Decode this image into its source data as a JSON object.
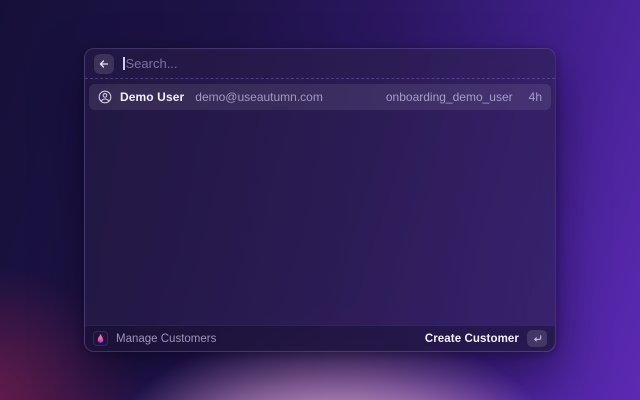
{
  "search": {
    "placeholder": "Search...",
    "value": ""
  },
  "results": [
    {
      "name": "Demo User",
      "email": "demo@useautumn.com",
      "id": "onboarding_demo_user",
      "time": "4h"
    }
  ],
  "footer": {
    "left_label": "Manage Customers",
    "create_label": "Create Customer"
  },
  "icons": {
    "back": "arrow-left-icon",
    "user": "user-circle-icon",
    "logo": "autumn-flame-icon",
    "enter": "return-key-icon"
  },
  "colors": {
    "background_gradient_start": "#151039",
    "background_gradient_end": "#5b2ab3",
    "background_glow_pink": "#eec0e0",
    "panel": "#2b1d4f",
    "row_highlight": "#3a2f63",
    "text_primary": "#f3f1fa",
    "text_muted": "#a299c4",
    "flame_orange": "#ffa04d",
    "flame_pink": "#f75b9a",
    "flame_purple": "#8f44e8"
  }
}
